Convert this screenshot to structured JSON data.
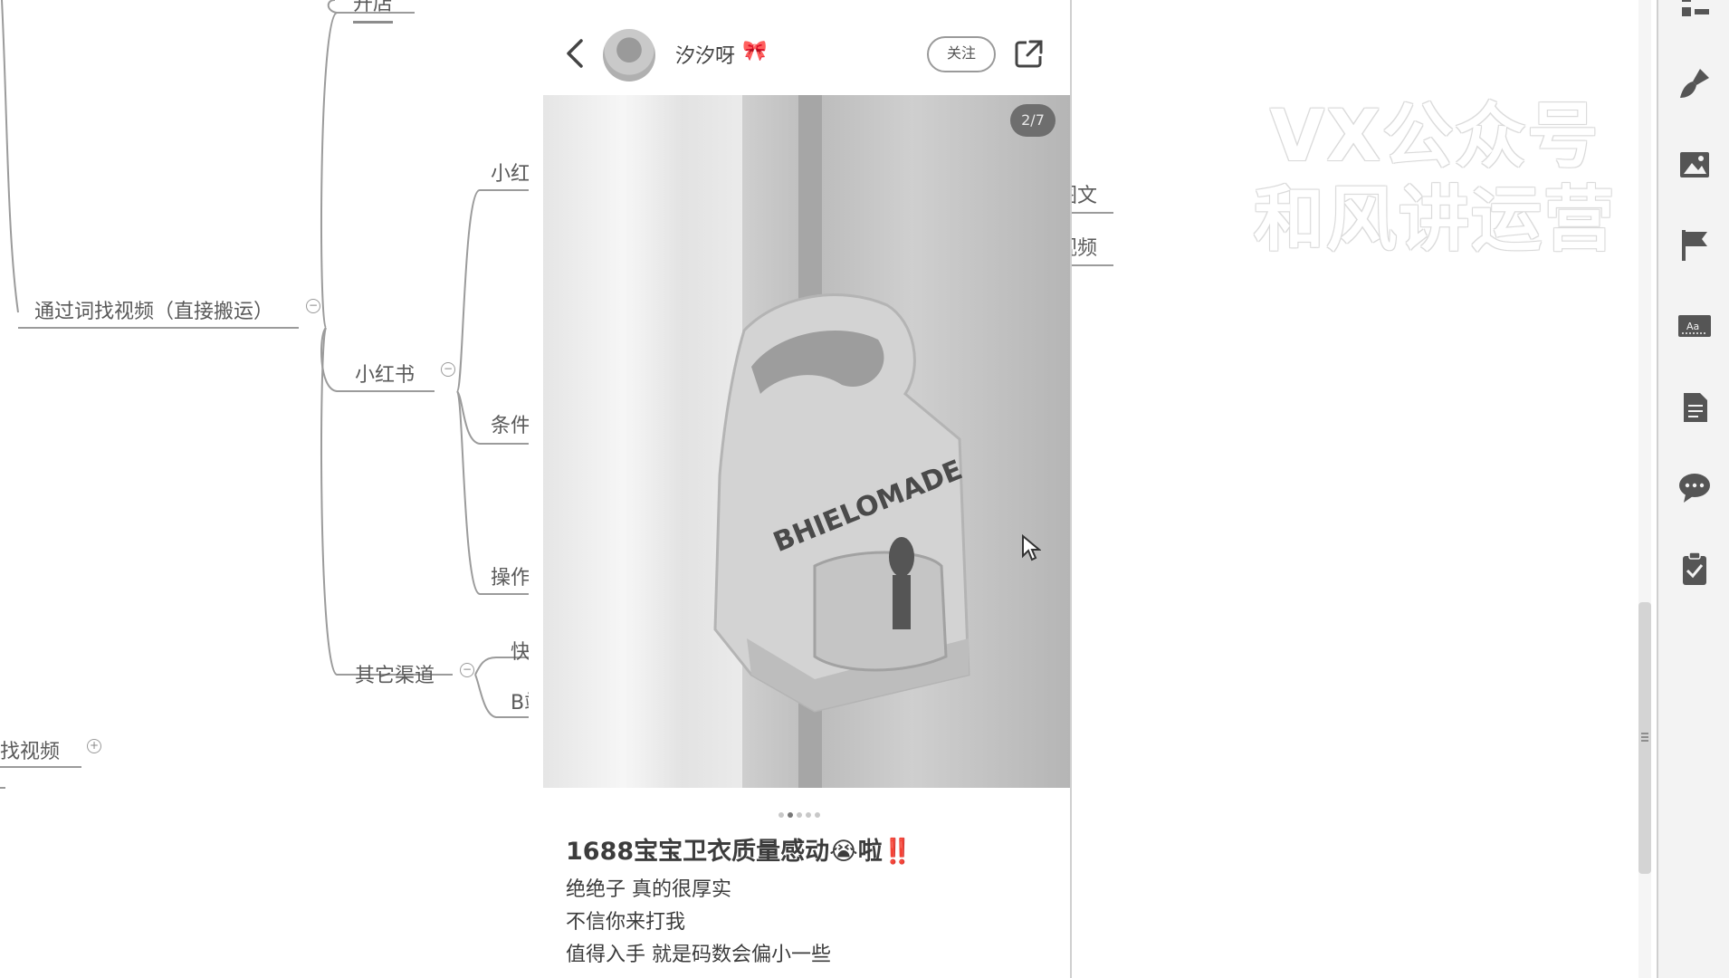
{
  "mindmap": {
    "nodes": {
      "top_partial": "开店",
      "root_left": "通过词找视频（直接搬运）",
      "xiaohongshu": "小红书",
      "xiaohongshu_sub": "小红书",
      "conditions": "条件",
      "operation": "操作",
      "other_channels": "其它渠道",
      "kuaishou": "快手",
      "bilibili": "B站",
      "find_video": "找视频",
      "tuwen": "图文",
      "shipin": "视频"
    },
    "watermark": [
      "VX公众号",
      "和风讲运营"
    ]
  },
  "phone": {
    "username": "汐汐呀",
    "bow": "🎀",
    "follow_label": "关注",
    "counter": "2/7",
    "post_title": "1688宝宝卫衣质量感动😭啦‼️",
    "post_lines": [
      "绝绝子 真的很厚实",
      "不信你来打我",
      "值得入手 就是码数会偏小一些"
    ],
    "hoodie_print": "BHIELOMADE"
  },
  "toolbar": {
    "icons": [
      "outline-icon",
      "brush-icon",
      "image-icon",
      "flag-icon",
      "text-style-icon",
      "document-icon",
      "comment-icon",
      "task-icon"
    ]
  }
}
